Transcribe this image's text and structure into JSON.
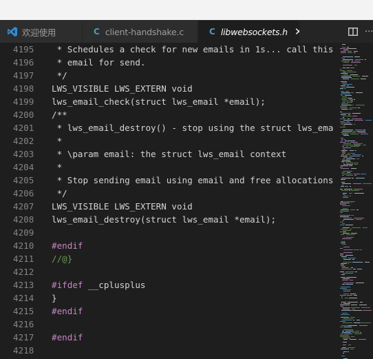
{
  "tabs": [
    {
      "label": "欢迎使用",
      "icon": "vscode-logo-icon",
      "active": false
    },
    {
      "label": "client-handshake.c",
      "icon": "c-file-icon",
      "active": false
    },
    {
      "label": "libwebsockets.h",
      "icon": "c-file-icon",
      "active": true,
      "close": "✕"
    }
  ],
  "editor_actions": {
    "split_icon": "split-editor-icon",
    "more_label": "···"
  },
  "code_lines": [
    {
      "num": "4195",
      "text": " * Schedules a check for new emails in 1s... call this",
      "kind": "comment"
    },
    {
      "num": "4196",
      "text": " * email for send.",
      "kind": "comment"
    },
    {
      "num": "4197",
      "text": " */",
      "kind": "comment"
    },
    {
      "num": "4198",
      "text": "LWS_VISIBLE LWS_EXTERN void",
      "kind": "code"
    },
    {
      "num": "4199",
      "text": "lws_email_check(struct lws_email *email);",
      "kind": "code"
    },
    {
      "num": "4200",
      "text": "/**",
      "kind": "comment"
    },
    {
      "num": "4201",
      "text": " * lws_email_destroy() - stop using the struct lws_ema",
      "kind": "comment"
    },
    {
      "num": "4202",
      "text": " *",
      "kind": "comment"
    },
    {
      "num": "4203",
      "text": " * \\param email: the struct lws_email context",
      "kind": "comment"
    },
    {
      "num": "4204",
      "text": " *",
      "kind": "comment"
    },
    {
      "num": "4205",
      "text": " * Stop sending email using email and free allocations",
      "kind": "comment"
    },
    {
      "num": "4206",
      "text": " */",
      "kind": "comment"
    },
    {
      "num": "4207",
      "text": "LWS_VISIBLE LWS_EXTERN void",
      "kind": "code"
    },
    {
      "num": "4208",
      "text": "lws_email_destroy(struct lws_email *email);",
      "kind": "code"
    },
    {
      "num": "4209",
      "text": "",
      "kind": "code"
    },
    {
      "num": "4210",
      "text": "#endif",
      "kind": "preproc"
    },
    {
      "num": "4211",
      "text": "//@}",
      "kind": "greencomment"
    },
    {
      "num": "4212",
      "text": "",
      "kind": "code"
    },
    {
      "num": "4213",
      "text": "#ifdef",
      "extra": " __cplusplus",
      "kind": "preproc"
    },
    {
      "num": "4214",
      "text": "}",
      "kind": "code"
    },
    {
      "num": "4215",
      "text": "#endif",
      "kind": "preproc"
    },
    {
      "num": "4216",
      "text": "",
      "kind": "code"
    },
    {
      "num": "4217",
      "text": "#endif",
      "kind": "preproc"
    },
    {
      "num": "4218",
      "text": "",
      "kind": "code"
    }
  ],
  "colors": {
    "background": "#1e1e1e",
    "tabbar": "#252526",
    "line_number": "#858585",
    "text": "#d4d4d4",
    "preprocessor": "#c586c0",
    "green_comment": "#6a9955",
    "c_icon": "#519aba"
  }
}
